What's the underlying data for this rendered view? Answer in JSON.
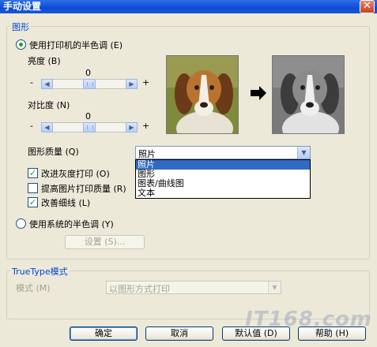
{
  "window": {
    "title": "手动设置",
    "close_glyph": "✕"
  },
  "graphics": {
    "group_label": "图形",
    "use_printer_halftone_label": "使用打印机的半色调 (E)",
    "brightness": {
      "label": "亮度 (B)",
      "value": "0",
      "minus": "-",
      "plus": "+"
    },
    "contrast": {
      "label": "对比度 (N)",
      "value": "0",
      "minus": "-",
      "plus": "+"
    },
    "quality": {
      "label": "图形质量 (Q)",
      "selected": "照片",
      "options": [
        "照片",
        "图形",
        "图表/曲线图",
        "文本"
      ]
    },
    "checkboxes": [
      {
        "label": "改进灰度打印 (O)",
        "checked": true
      },
      {
        "label": "提高图片打印质量 (R)",
        "checked": false
      },
      {
        "label": "改善细线 (L)",
        "checked": true
      }
    ],
    "use_system_halftone_label": "使用系统的半色调 (Y)",
    "settings_button": "设置 (S)..."
  },
  "truetype": {
    "group_label": "TrueType模式",
    "mode_label": "模式 (M)",
    "mode_value": "以图形方式打印"
  },
  "buttons": {
    "ok": "确定",
    "cancel": "取消",
    "default": "默认值 (D)",
    "help": "帮助 (H)"
  },
  "watermark": "IT168.com",
  "icons": {
    "arrow": "right-arrow-icon",
    "close": "close-icon",
    "dropdown": "chevron-down-icon"
  }
}
